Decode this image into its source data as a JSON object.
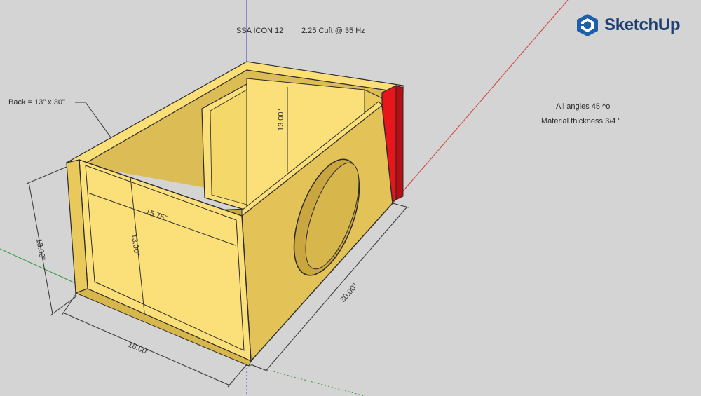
{
  "app": {
    "logo_text": "SketchUp"
  },
  "annotations": {
    "title": "SSA ICON 12",
    "volume": "2.25 Cuft @ 35 Hz",
    "back_note": "Back = 13\" x 30\"",
    "angles_note": "All angles 45 ^o",
    "material_note": "Material thickness 3/4 \""
  },
  "dimensions": {
    "height_left": "13.00\"",
    "width_front": "18.00\"",
    "length_right": "30.00\"",
    "inner_width": "15.75\"",
    "inner_height": "13.00\"",
    "back_inner_height": "13.00\""
  },
  "colors": {
    "background": "#d4d4d4",
    "wood_light": "#fbe07a",
    "wood_mid": "#e9c95c",
    "wood_dark": "#c9a640",
    "highlight_red": "#e8151c",
    "axis_red": "#d23a3a",
    "axis_green": "#2f9a3a",
    "axis_blue": "#3a3aca",
    "logo_blue": "#1d3f73"
  }
}
